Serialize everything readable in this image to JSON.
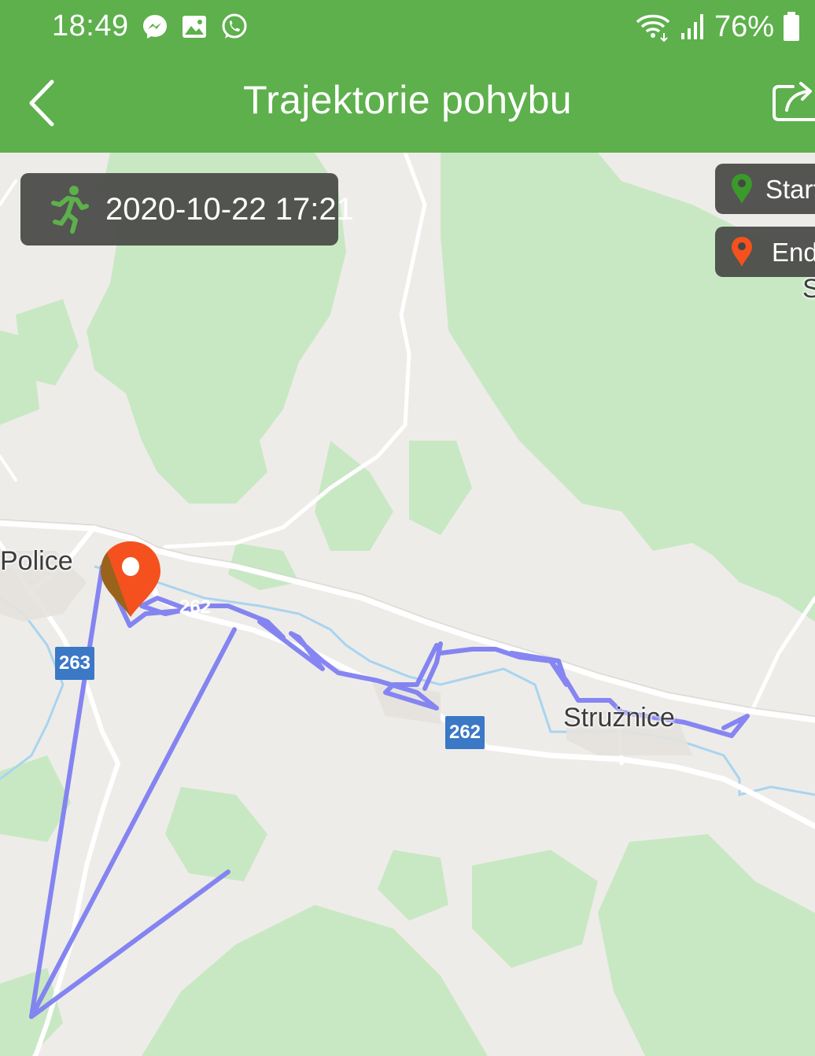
{
  "status_bar": {
    "time": "18:49",
    "battery": "76%",
    "left_icons": [
      "messenger-icon",
      "gallery-icon",
      "whatsapp-icon"
    ],
    "right_icons": [
      "wifi-icon",
      "signal-icon",
      "battery-icon"
    ]
  },
  "header": {
    "title": "Trajektorie pohybu",
    "back_icon": "chevron-left-icon",
    "share_icon": "share-icon",
    "background_color": "#5db04b"
  },
  "time_chip": {
    "timestamp": "2020-10-22 17:21",
    "icon": "runner-icon"
  },
  "legend": [
    {
      "label": "Start",
      "color": "#3a9a2a",
      "icon": "map-pin-icon"
    },
    {
      "label": "End",
      "color": "#f4511e",
      "icon": "map-pin-icon"
    }
  ],
  "map": {
    "places": [
      "Police",
      "Strużnice",
      "S"
    ],
    "road_shields": [
      "263",
      "262"
    ],
    "road_inline_label": "262",
    "track_color": "#7f7ff2",
    "end_marker_color": "#f4511e"
  }
}
